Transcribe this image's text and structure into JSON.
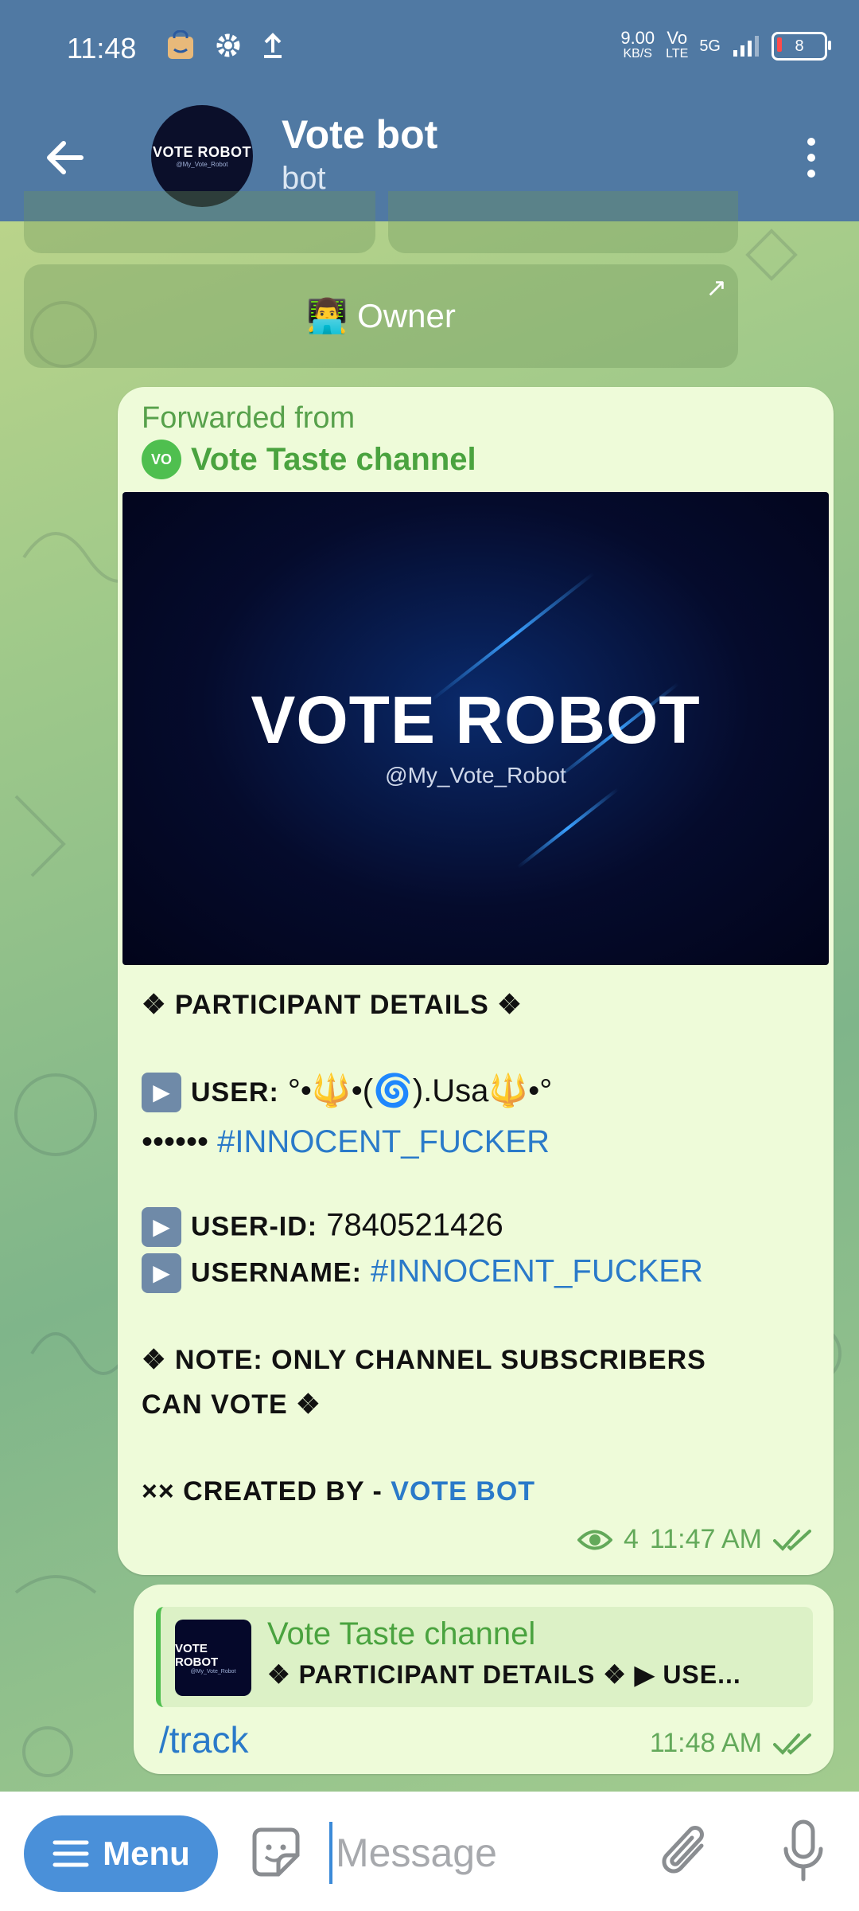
{
  "status_bar": {
    "time": "11:48",
    "speed_value": "9.00",
    "speed_unit": "KB/S",
    "volte_top": "Vo",
    "volte_bottom": "LTE",
    "network": "5G",
    "battery": "8"
  },
  "header": {
    "title": "Vote bot",
    "subtitle": "bot",
    "avatar_text": "VOTE ROBOT",
    "avatar_handle": "@My_Vote_Robot"
  },
  "keyboard": {
    "owner_label": "👨‍💻 Owner"
  },
  "forwarded_message": {
    "forwarded_label": "Forwarded from",
    "channel_badge": "VO",
    "channel_name": "Vote Taste channel",
    "image_title": "VOTE ROBOT",
    "image_handle": "@My_Vote_Robot",
    "heading": "❖ PARTICIPANT DETAILS ❖",
    "play_symbol": "▶",
    "user_label": "USER:",
    "user_value": "°•🔱•(🌀).Usa🔱•°",
    "user_line2_prefix": "•••••• ",
    "user_tag": "#INNOCENT_FUCKER",
    "user_id_label": "USER-ID:",
    "user_id_value": "7840521426",
    "username_label": "USERNAME:",
    "username_value": "#INNOCENT_FUCKER",
    "note_line1": "❖ NOTE: ONLY CHANNEL SUBSCRIBERS",
    "note_line2": "CAN VOTE ❖",
    "created_prefix": "×× CREATED BY - ",
    "created_link": "VOTE BOT",
    "views": "4",
    "time": "11:47 AM"
  },
  "reply_message": {
    "reply_title": "Vote Taste channel",
    "reply_snippet": "❖ PARTICIPANT DETAILS ❖ ▶ USE...",
    "thumb_text": "VOTE ROBOT",
    "thumb_handle": "@My_Vote_Robot",
    "text": "/track",
    "time": "11:48 AM"
  },
  "input_bar": {
    "menu_label": "Menu",
    "placeholder": "Message"
  },
  "colors": {
    "header": "#5079a3",
    "bubble": "#eefbd9",
    "accent_green": "#4aa33f",
    "link_blue": "#2a7ac9",
    "menu_button": "#4a90d9"
  }
}
